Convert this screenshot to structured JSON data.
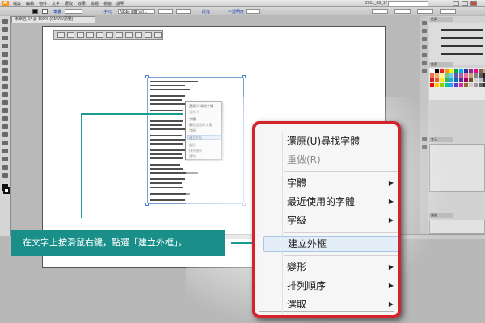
{
  "app": {
    "logo": "Ai",
    "menu": [
      "檔案",
      "編輯",
      "物件",
      "文字",
      "選取",
      "效果",
      "檢視",
      "視窗",
      "說明"
    ],
    "date_text": "2011_08_17"
  },
  "control_bar": {
    "label_stroke": "筆畫",
    "label_char": "字元",
    "font_value": "Adobe 明體 Std L",
    "label_paragraph": "段落",
    "label_opacity": "不透明度"
  },
  "document_tab": "未命名-1* @ 100% (CMYK/預覽)",
  "small_menu": {
    "items": [
      "還原(U)尋找字體",
      "重做(R)",
      "字體",
      "最近使用的字體",
      "字級",
      "建立外框",
      "變形",
      "排列順序",
      "選取"
    ]
  },
  "right_panels": {
    "tab_color": "色彩",
    "tab_swatches": "色票",
    "tab_character": "字元",
    "tab_layers": "圖層"
  },
  "context_menu": {
    "items": [
      {
        "label": "還原(U)尋找字體",
        "submenu": false,
        "disabled": false
      },
      {
        "label": "重做(R)",
        "submenu": false,
        "disabled": true
      },
      {
        "label": "字體",
        "submenu": true,
        "disabled": false
      },
      {
        "label": "最近使用的字體",
        "submenu": true,
        "disabled": false
      },
      {
        "label": "字級",
        "submenu": true,
        "disabled": false
      },
      {
        "label": "建立外框",
        "submenu": false,
        "disabled": false,
        "highlighted": true
      },
      {
        "label": "變形",
        "submenu": true,
        "disabled": false
      },
      {
        "label": "排列順序",
        "submenu": true,
        "disabled": false
      },
      {
        "label": "選取",
        "submenu": true,
        "disabled": false
      }
    ]
  },
  "callout": {
    "text": "在文字上按滑鼠右鍵，點選「建立外框」。"
  },
  "colors": {
    "callout_bg": "#1a8f8a",
    "menu_border": "#d4232a",
    "highlight": "#e4eef9"
  }
}
